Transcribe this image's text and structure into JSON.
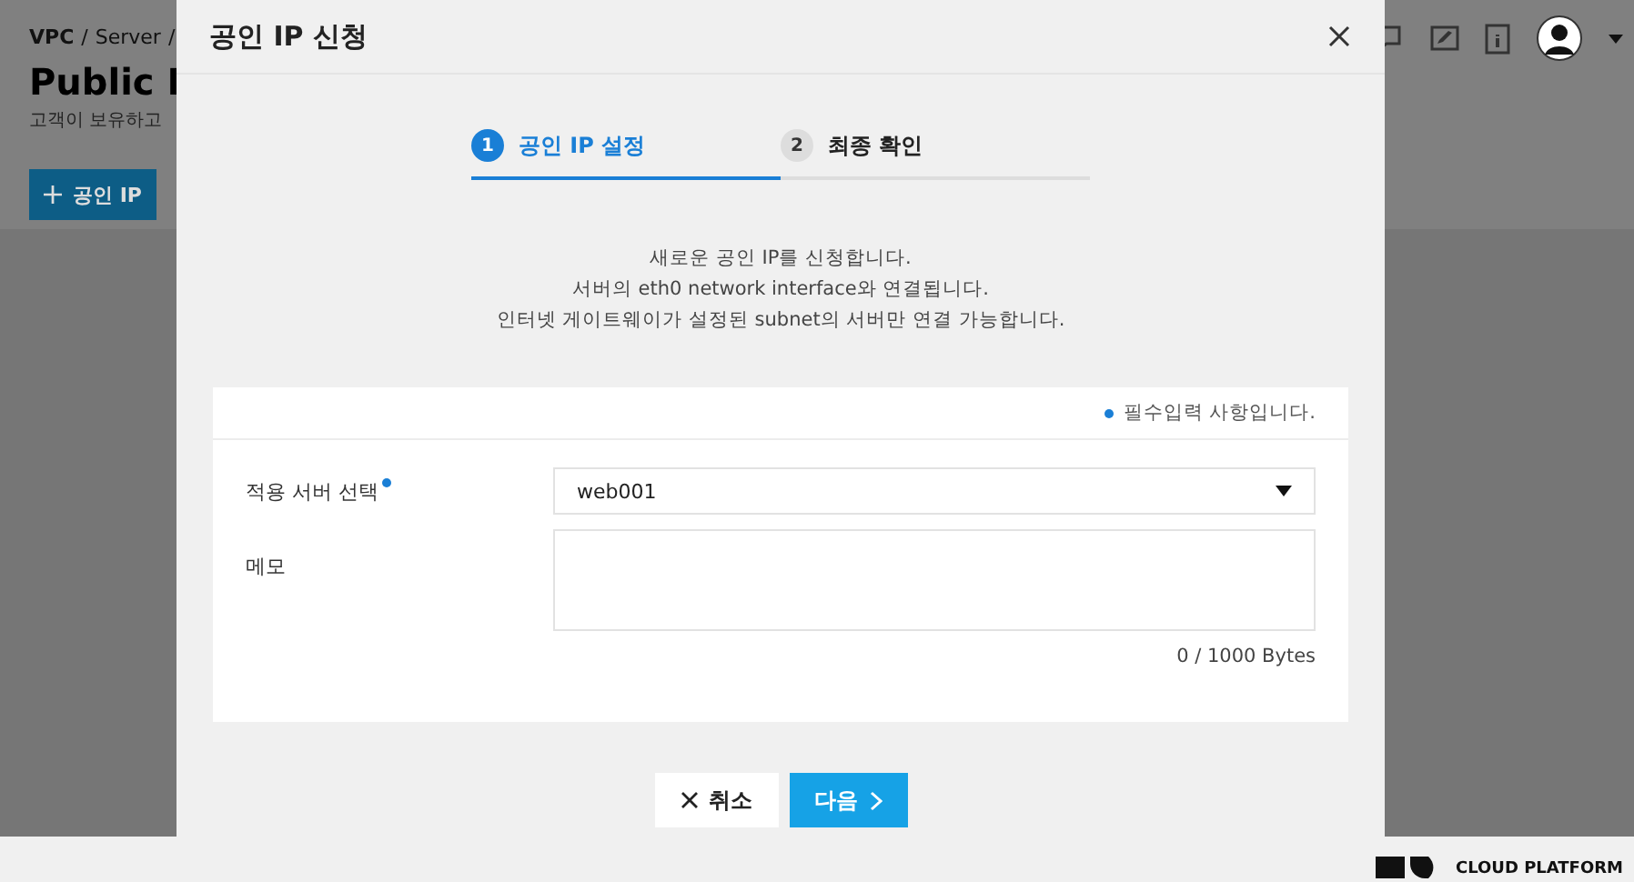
{
  "background_page": {
    "breadcrumb": {
      "items": [
        "VPC",
        "Server"
      ],
      "separator": "/"
    },
    "title": "Public I",
    "subtitle": "고객이 보유하고",
    "create_button": "공인 IP"
  },
  "modal": {
    "title": "공인 IP 신청",
    "steps": [
      {
        "number": "1",
        "label": "공인 IP 설정",
        "selected": true
      },
      {
        "number": "2",
        "label": "최종 확인",
        "selected": false
      }
    ],
    "description": [
      "새로운 공인 IP를 신청합니다.",
      "서버의 eth0 network interface와 연결됩니다.",
      "인터넷 게이트웨이가 설정된 subnet의 서버만 연결 가능합니다."
    ],
    "required_note": "필수입력 사항입니다.",
    "fields": [
      {
        "kind": "select",
        "label": "적용 서버 선택",
        "required": true,
        "value": "web001"
      },
      {
        "kind": "textarea",
        "label": "메모",
        "counter": "0 / 1000 Bytes"
      }
    ],
    "buttons": [
      {
        "kind": "cancel",
        "label": "취소"
      },
      {
        "kind": "next",
        "label": "다음"
      }
    ]
  },
  "footer": {
    "logo_text": "CLOUD PLATFORM"
  }
}
